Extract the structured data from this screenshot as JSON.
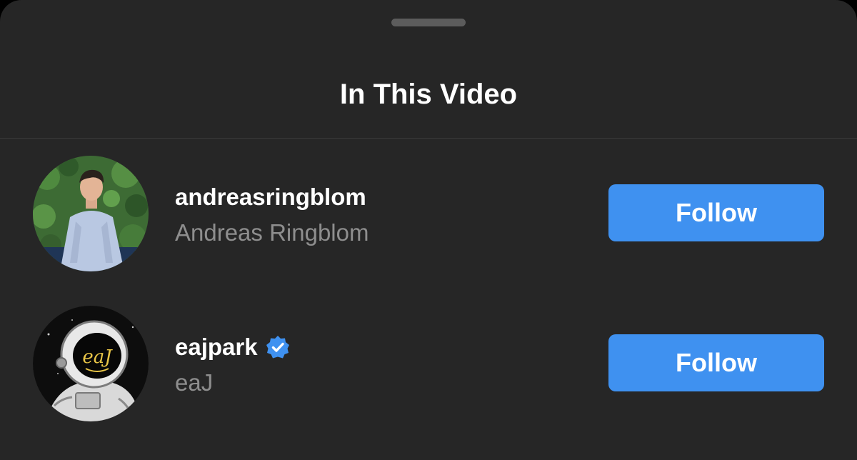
{
  "sheet": {
    "title": "In This Video"
  },
  "people": [
    {
      "username": "andreasringblom",
      "full_name": "Andreas Ringblom",
      "verified": false,
      "follow_label": "Follow"
    },
    {
      "username": "eajpark",
      "full_name": "eaJ",
      "verified": true,
      "follow_label": "Follow",
      "avatar_lettering": "eaJ"
    }
  ],
  "colors": {
    "background": "#262626",
    "follow_button": "#3f91f0",
    "secondary_text": "#8e8e8e",
    "verified_badge": "#3f91f0"
  }
}
